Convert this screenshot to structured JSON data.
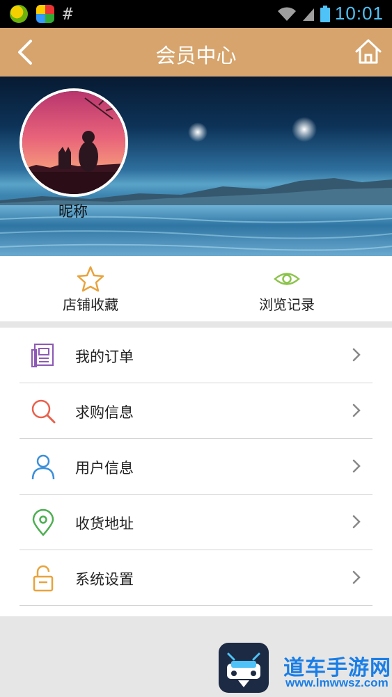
{
  "status_bar": {
    "time": "10:01",
    "left_icons": [
      "app-icon-green",
      "app-icon-colorful",
      "hash-icon"
    ],
    "hash_glyph": "#",
    "right_icons": [
      "wifi-icon",
      "signal-icon",
      "battery-icon"
    ]
  },
  "header": {
    "title": "会员中心",
    "back_icon": "chevron-left-icon",
    "home_icon": "home-icon",
    "background": "#d6a46c"
  },
  "profile": {
    "nickname": "昵称"
  },
  "quick_actions": [
    {
      "label": "店铺收藏",
      "icon": "star-icon",
      "color": "#e8a33d"
    },
    {
      "label": "浏览记录",
      "icon": "eye-icon",
      "color": "#8bc34a"
    }
  ],
  "menu": [
    {
      "label": "我的订单",
      "icon": "order-doc-icon",
      "color": "#8e5bb5"
    },
    {
      "label": "求购信息",
      "icon": "search-icon",
      "color": "#e8604c"
    },
    {
      "label": "用户信息",
      "icon": "user-icon",
      "color": "#3b8fd9"
    },
    {
      "label": "收货地址",
      "icon": "location-pin-icon",
      "color": "#4caf50"
    },
    {
      "label": "系统设置",
      "icon": "unlock-icon",
      "color": "#e8a33d"
    }
  ],
  "watermark": {
    "text": "道车手游网",
    "url": "www.lmwwsz.com"
  }
}
